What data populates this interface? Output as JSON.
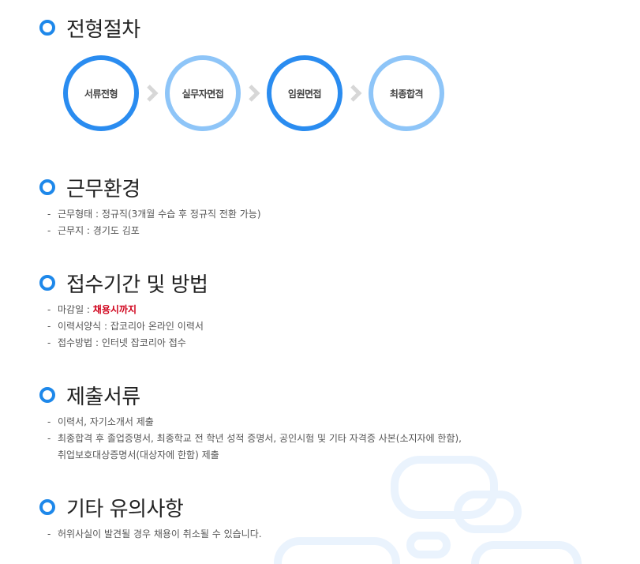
{
  "process": {
    "title": "전형절차",
    "steps": [
      {
        "label": "서류전형",
        "style": "dark"
      },
      {
        "label": "실무자면접",
        "style": "light"
      },
      {
        "label": "임원면접",
        "style": "dark"
      },
      {
        "label": "최종합격",
        "style": "light"
      }
    ]
  },
  "work_environment": {
    "title": "근무환경",
    "items": [
      "근무형태 : 정규직(3개월 수습 후 정규직 전환 가능)",
      "근무지 : 경기도 김포"
    ]
  },
  "application": {
    "title": "접수기간 및 방법",
    "deadline_label": "마감일 : ",
    "deadline_value": "채용시까지",
    "items": [
      "이력서양식 : 잡코리아 온라인 이력서",
      "접수방법 : 인터넷 잡코리아 접수"
    ]
  },
  "documents": {
    "title": "제출서류",
    "items": [
      "이력서, 자기소개서 제출",
      "최종합격 후 졸업증명서, 최종학교 전 학년 성적 증명서, 공인시험 및 기타 자격증 사본(소지자에 한함),"
    ],
    "continuation": "취업보호대상증명서(대상자에 한함) 제출"
  },
  "notes": {
    "title": "기타 유의사항",
    "items": [
      "허위사실이 발견될 경우 채용이 취소될 수 있습니다."
    ]
  },
  "colors": {
    "accent": "#1e88ea",
    "step_dark": "#2a8cf0",
    "step_light": "#8ec5f8",
    "deadline": "#d0021b"
  }
}
